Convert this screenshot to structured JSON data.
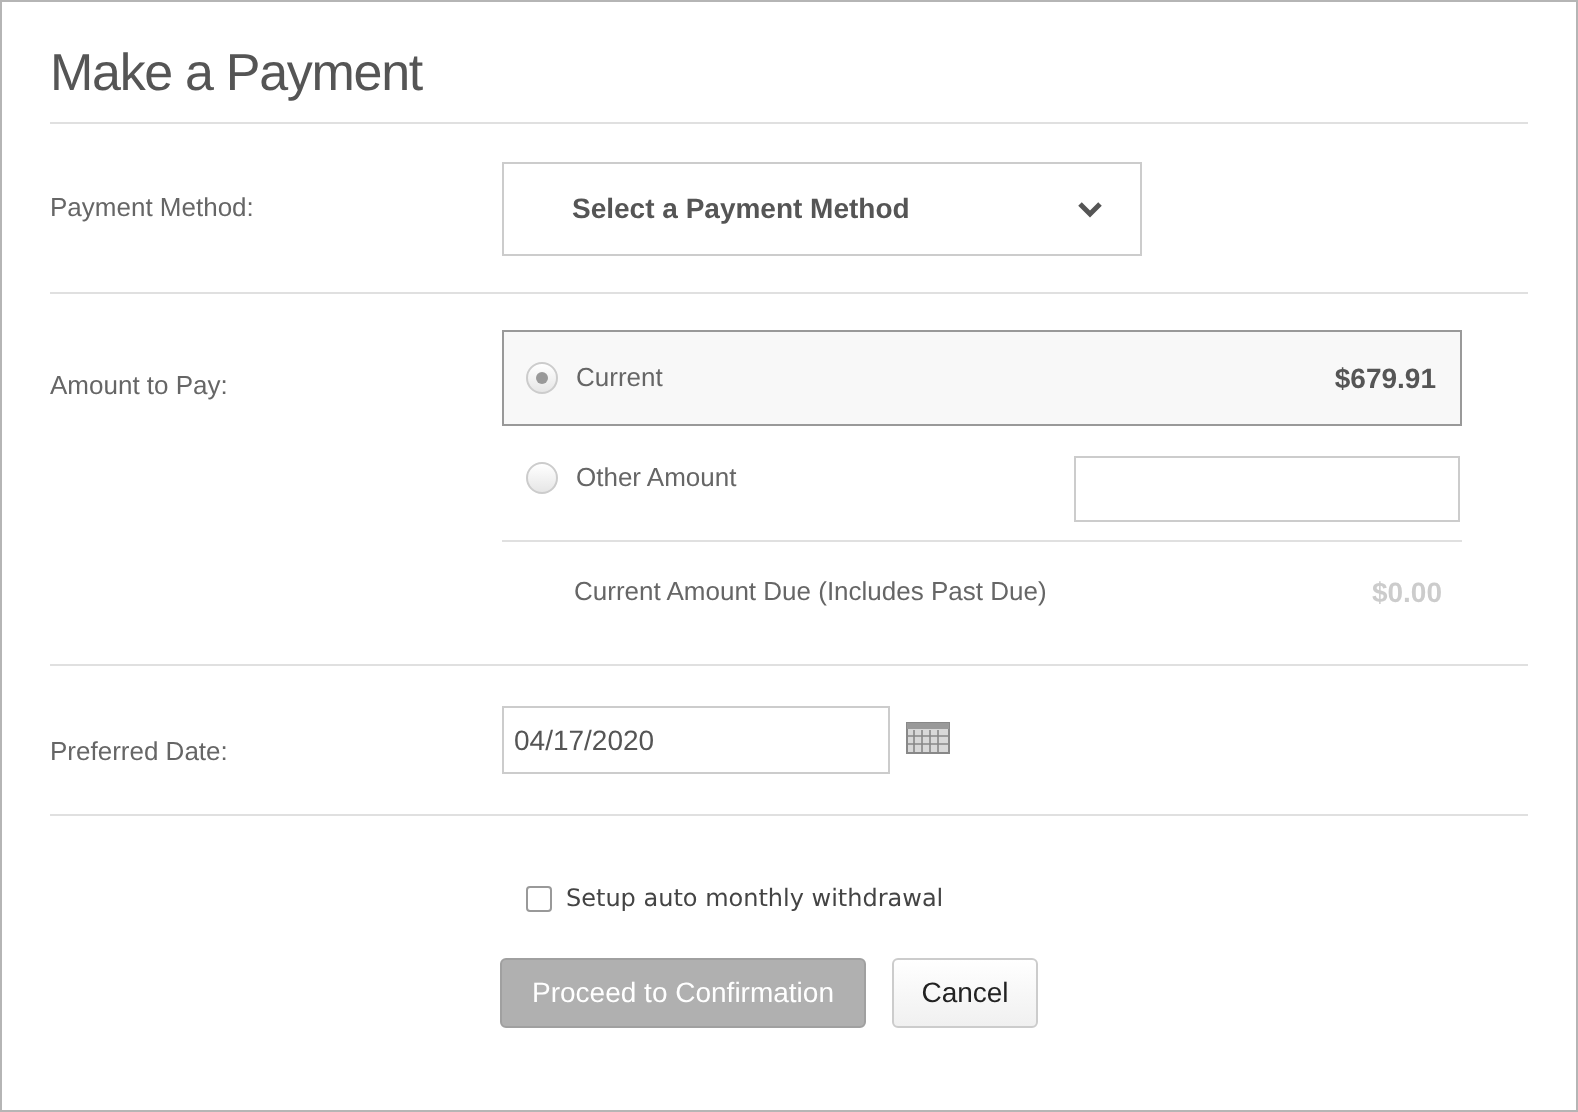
{
  "title": "Make a Payment",
  "payment_method": {
    "label": "Payment Method:",
    "placeholder": "Select a Payment Method"
  },
  "amount": {
    "label": "Amount to Pay:",
    "options": [
      {
        "kind": "fixed",
        "label": "Current",
        "value": "$679.91",
        "selected": true
      },
      {
        "kind": "input",
        "label": "Other Amount",
        "selected": false
      }
    ],
    "due_label": "Current Amount Due (Includes Past Due)",
    "due_value": "$0.00"
  },
  "date": {
    "label": "Preferred Date:",
    "value": "04/17/2020"
  },
  "auto_withdrawal": {
    "label": "Setup auto monthly withdrawal",
    "checked": false
  },
  "buttons": [
    {
      "kind": "primary",
      "label": "Proceed to Confirmation",
      "disabled": true
    },
    {
      "kind": "secondary",
      "label": "Cancel",
      "disabled": false
    }
  ]
}
